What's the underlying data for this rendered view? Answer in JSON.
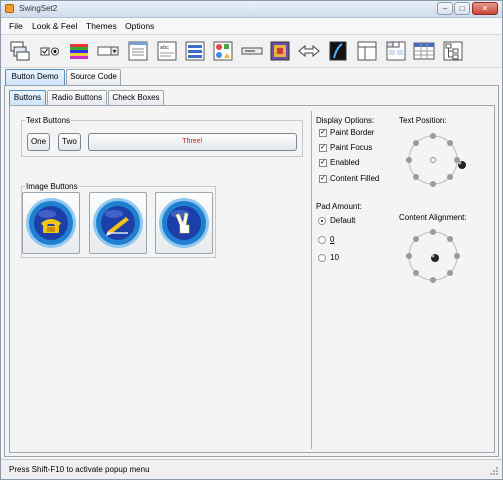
{
  "window": {
    "title": "SwingSet2",
    "controls": [
      "minimize",
      "maximize",
      "close"
    ],
    "minimize_glyph": "–",
    "maximize_glyph": "□",
    "close_glyph": "✕"
  },
  "menu": {
    "items": [
      {
        "label": "File",
        "mnemonic": "F"
      },
      {
        "label": "Look & Feel",
        "mnemonic": "L"
      },
      {
        "label": "Themes",
        "mnemonic": "T"
      },
      {
        "label": "Options",
        "mnemonic": "O"
      }
    ]
  },
  "toolbar": {
    "icons": [
      "internal-frame-icon",
      "button-demo-icon",
      "color-chooser-icon",
      "combo-box-icon",
      "file-chooser-icon",
      "editor-pane-icon",
      "html-icon",
      "list-icon",
      "option-pane-icon",
      "progress-bar-icon",
      "scroll-pane-icon",
      "slider-icon",
      "split-pane-icon",
      "tabbed-pane-icon",
      "table-icon",
      "tooltip-icon",
      "tree-icon"
    ]
  },
  "tabs": {
    "main": [
      {
        "label": "Button Demo",
        "selected": true
      },
      {
        "label": "Source Code",
        "selected": false
      }
    ],
    "sub": [
      {
        "label": "Buttons",
        "selected": true
      },
      {
        "label": "Radio Buttons",
        "selected": false
      },
      {
        "label": "Check Boxes",
        "selected": false
      }
    ]
  },
  "text_buttons": {
    "title": "Text Buttons",
    "one": "One",
    "two": "Two",
    "three": "Three!",
    "three_color": "#d02020"
  },
  "image_buttons": {
    "title": "Image Buttons",
    "items": [
      "phone-icon",
      "write-icon",
      "peace-icon"
    ]
  },
  "display_options": {
    "title": "Display Options:",
    "items": [
      {
        "label": "Paint Border",
        "checked": true
      },
      {
        "label": "Paint Focus",
        "checked": true
      },
      {
        "label": "Enabled",
        "checked": true
      },
      {
        "label": "Content Filled",
        "checked": true
      }
    ]
  },
  "pad_amount": {
    "title": "Pad Amount:",
    "items": [
      {
        "label": "Default",
        "selected": true
      },
      {
        "label": "0",
        "selected": false
      },
      {
        "label": "10",
        "selected": false
      }
    ]
  },
  "text_position": {
    "title": "Text Position:",
    "selected": "right"
  },
  "content_alignment": {
    "title": "Content Alignment:",
    "selected": "center"
  },
  "status": {
    "text": "Press Shift-F10 to activate popup menu"
  },
  "colors": {
    "button_blue": "#1c3fa8",
    "button_ring": "#2a8fd8",
    "titlebar": "#d8e4f2",
    "tab_selected": "#cfe4fb"
  }
}
